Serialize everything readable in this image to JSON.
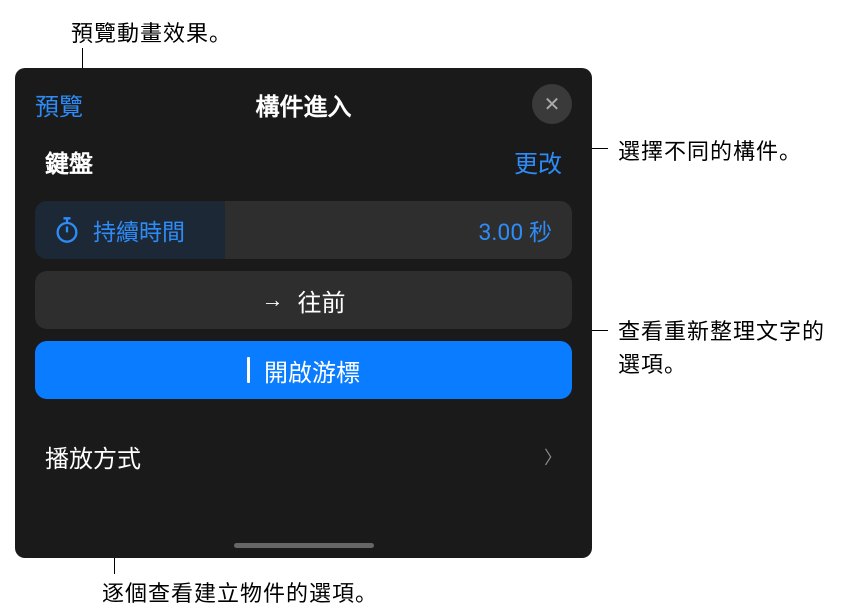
{
  "annotations": {
    "top": "預覽動畫效果。",
    "right_change": "選擇不同的構件。",
    "right_direction": "查看重新整理文字的選項。",
    "bottom": "逐個查看建立物件的選項。"
  },
  "panel": {
    "preview": "預覽",
    "title": "構件進入",
    "close": "✕",
    "keyboard": "鍵盤",
    "change": "更改",
    "duration": {
      "label": "持續時間",
      "value": "3.00 秒"
    },
    "direction": {
      "label": "往前"
    },
    "cursor": {
      "label": "開啟游標"
    },
    "playback": {
      "label": "播放方式"
    }
  }
}
